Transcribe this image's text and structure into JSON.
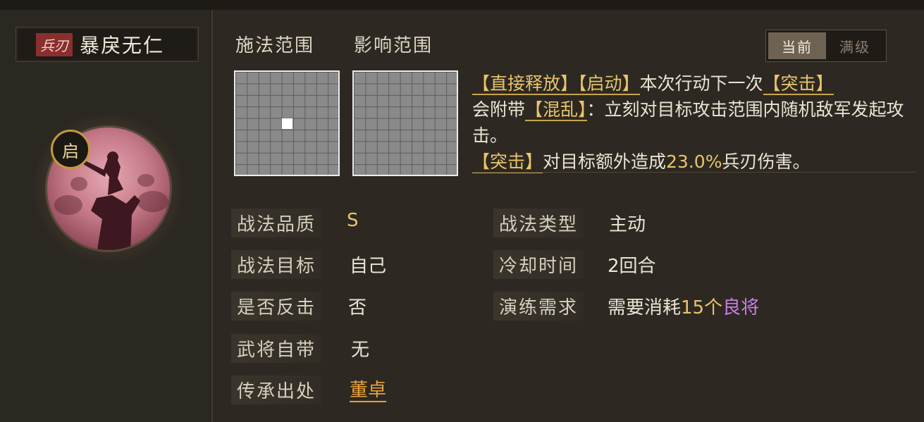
{
  "skill": {
    "type_tag": "兵刃",
    "name": "暴戾无仁",
    "badge": "启"
  },
  "ranges": {
    "cast_label": "施法范围",
    "effect_label": "影响范围"
  },
  "toggle": {
    "current": "当前",
    "max": "满级"
  },
  "description": {
    "p1_kw1": "【直接释放】",
    "p1_kw2": "【启动】",
    "p1_text1": "本次行动下一次",
    "p1_kw3": "【突击】",
    "p1_text2": "会附带",
    "p1_kw4": "【混乱】",
    "p1_text3": "：立刻对目标攻击范围内随机敌军发起攻击。",
    "p2_kw1": "【突击】",
    "p2_text1": "对目标额外造成",
    "p2_num": "23.0%",
    "p2_text2": "兵刃伤害。"
  },
  "attributes": {
    "quality_label": "战法品质",
    "quality_value": "S",
    "target_label": "战法目标",
    "target_value": "自己",
    "counter_label": "是否反击",
    "counter_value": "否",
    "innate_label": "武将自带",
    "innate_value": "无",
    "origin_label": "传承出处",
    "origin_value": "董卓",
    "kind_label": "战法类型",
    "kind_value": "主动",
    "cooldown_label": "冷却时间",
    "cooldown_value": "2回合",
    "train_label": "演练需求",
    "train_text1": "需要消耗",
    "train_num": "15个",
    "train_item": "良将"
  },
  "colors": {
    "gold": "#e9c46a",
    "purple": "#c77ee6",
    "tag_red": "#8a2e2e"
  }
}
